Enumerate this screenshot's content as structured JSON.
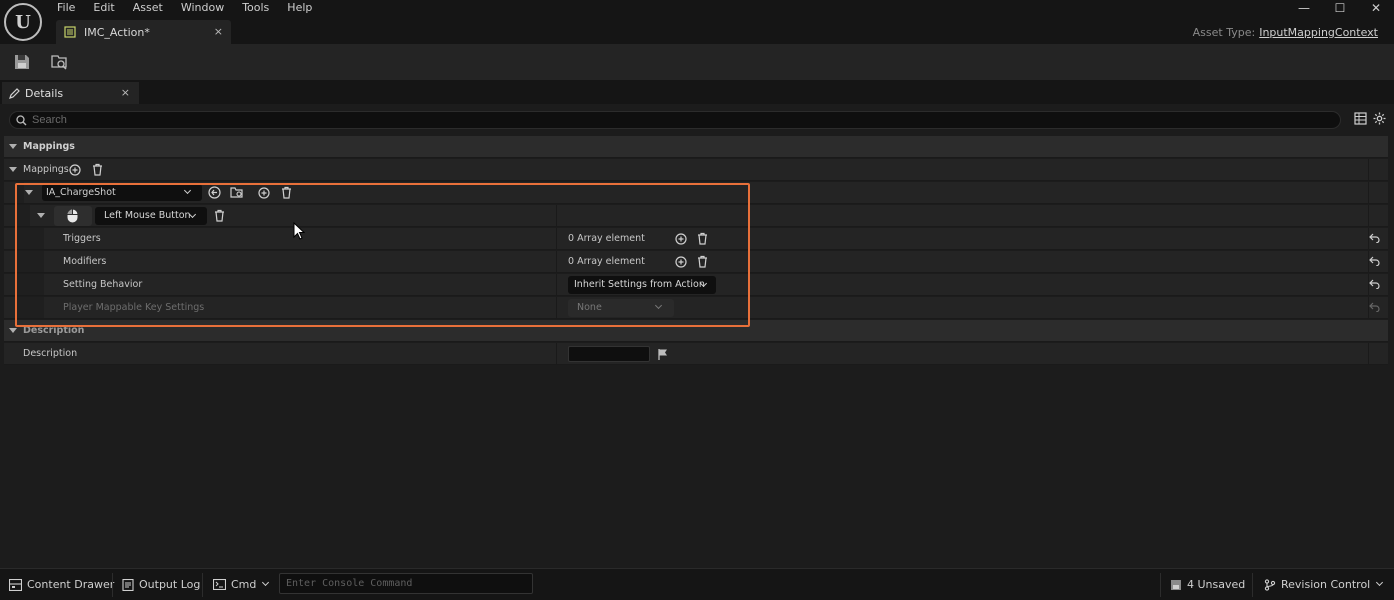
{
  "app": {
    "logo_text": "U"
  },
  "menu": [
    "File",
    "Edit",
    "Asset",
    "Window",
    "Tools",
    "Help"
  ],
  "document_tab": {
    "label": "IMC_Action*",
    "close": "×"
  },
  "window_controls": [
    "—",
    "☐",
    "✕"
  ],
  "asset_type": {
    "label": "Asset Type:",
    "value": "InputMappingContext"
  },
  "details_tab": {
    "label": "Details",
    "close": "×"
  },
  "search": {
    "placeholder": "Search"
  },
  "rows": {
    "mappings_category": "Mappings",
    "mappings_array": "Mappings",
    "input_action": "IA_ChargeShot",
    "key": "Left Mouse Button",
    "triggers": {
      "label": "Triggers",
      "value": "0 Array element"
    },
    "modifiers": {
      "label": "Modifiers",
      "value": "0 Array element"
    },
    "setting_behavior": {
      "label": "Setting Behavior",
      "value": "Inherit Settings from Action"
    },
    "player_mappable": {
      "label": "Player Mappable Key Settings",
      "value": "None"
    },
    "description_category": "Description",
    "description": {
      "label": "Description",
      "value": ""
    }
  },
  "statusbar": {
    "content_drawer": "Content Drawer",
    "output_log": "Output Log",
    "cmd": "Cmd",
    "console_placeholder": "Enter Console Command",
    "unsaved": "4 Unsaved",
    "revision_control": "Revision Control"
  },
  "colors": {
    "highlight": "#e8703a",
    "background": "#151515",
    "panel": "#242424"
  }
}
